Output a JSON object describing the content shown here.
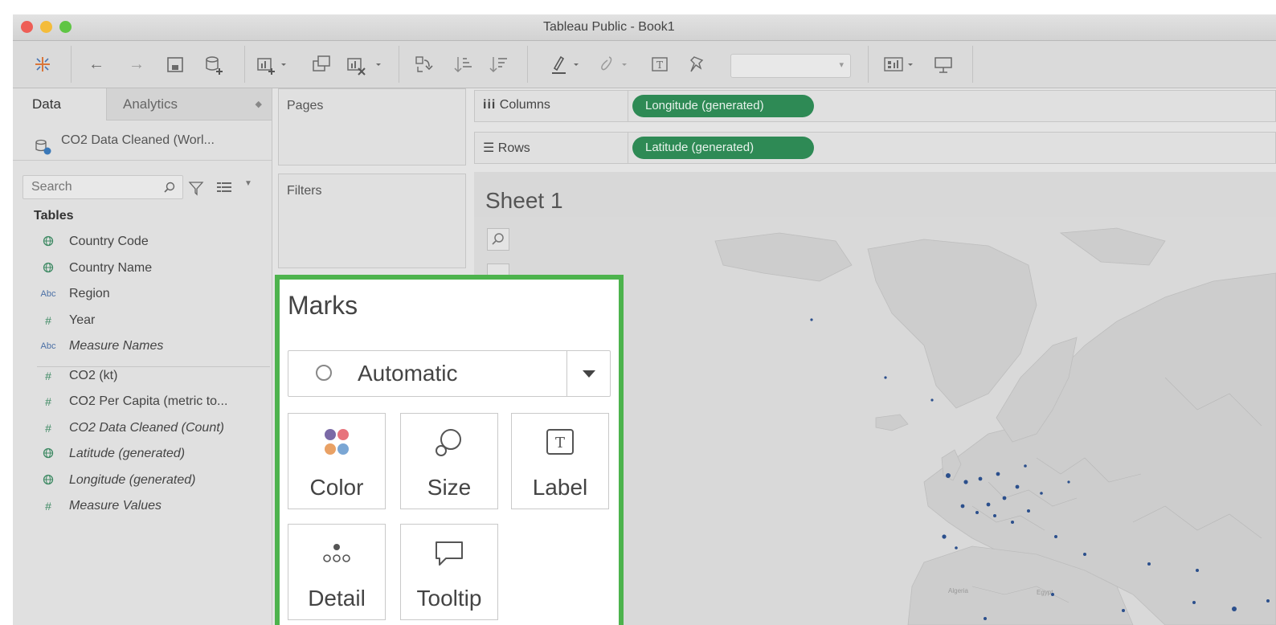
{
  "window": {
    "title": "Tableau Public - Book1",
    "traffic_colors": [
      "#ee5e56",
      "#f4bc3a",
      "#5fc544"
    ]
  },
  "toolbar": {
    "icons": [
      "tableau-logo-icon",
      "undo-icon",
      "redo-icon",
      "save-icon",
      "new-data-source-icon",
      "new-worksheet-icon",
      "duplicate-sheet-icon",
      "clear-sheet-icon",
      "swap-icon",
      "sort-ascending-icon",
      "sort-descending-icon",
      "highlight-icon",
      "group-icon",
      "label-icon",
      "pin-icon",
      "show-me-icon",
      "presentation-icon"
    ]
  },
  "data_pane": {
    "tabs": {
      "data": "Data",
      "analytics": "Analytics"
    },
    "data_source": "CO2 Data Cleaned (Worl...",
    "search": {
      "placeholder": "Search"
    },
    "tables_heading": "Tables",
    "fields": [
      {
        "type": "geo",
        "icon": "globe-icon",
        "label": "Country Code",
        "italic": false
      },
      {
        "type": "geo",
        "icon": "globe-icon",
        "label": "Country Name",
        "italic": false
      },
      {
        "type": "abc",
        "icon": "Abc",
        "label": "Region",
        "italic": false
      },
      {
        "type": "num",
        "icon": "#",
        "label": "Year",
        "italic": false
      },
      {
        "type": "abc",
        "icon": "Abc",
        "label": "Measure Names",
        "italic": true
      },
      {
        "type": "num",
        "icon": "#",
        "label": "CO2 (kt)",
        "italic": false
      },
      {
        "type": "num",
        "icon": "#",
        "label": "CO2 Per Capita (metric to...",
        "italic": false
      },
      {
        "type": "num",
        "icon": "#",
        "label": "CO2 Data Cleaned (Count)",
        "italic": true
      },
      {
        "type": "geo",
        "icon": "globe-icon",
        "label": "Latitude (generated)",
        "italic": true
      },
      {
        "type": "geo",
        "icon": "globe-icon",
        "label": "Longitude (generated)",
        "italic": true
      },
      {
        "type": "num",
        "icon": "#",
        "label": "Measure Values",
        "italic": true
      }
    ]
  },
  "shelves": {
    "pages": "Pages",
    "filters": "Filters",
    "columns": {
      "label": "Columns",
      "pill": "Longitude (generated)"
    },
    "rows": {
      "label": "Rows",
      "pill": "Latitude (generated)"
    }
  },
  "marks": {
    "title": "Marks",
    "mark_type": "Automatic",
    "buttons": [
      {
        "name": "color",
        "label": "Color"
      },
      {
        "name": "size",
        "label": "Size"
      },
      {
        "name": "label",
        "label": "Label"
      },
      {
        "name": "detail",
        "label": "Detail"
      },
      {
        "name": "tooltip",
        "label": "Tooltip"
      }
    ],
    "highlight_color": "#4db34d",
    "color_swatches": [
      "#7b6aa6",
      "#e7737c",
      "#e9a165",
      "#7aa6d4"
    ]
  },
  "sheet": {
    "title": "Sheet 1",
    "map_labels": {
      "algeria": "Algeria",
      "egypt": "Egypt"
    }
  },
  "colors": {
    "pill": "#2e8a55",
    "point": "#2b4f8c"
  }
}
